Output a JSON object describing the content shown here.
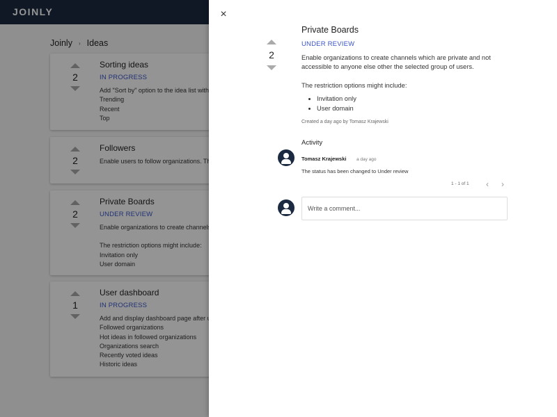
{
  "app": {
    "logo": "JOINLY"
  },
  "breadcrumb": {
    "items": [
      "Joinly",
      "Ideas"
    ],
    "separator": "›"
  },
  "cards": [
    {
      "votes": "2",
      "title": "Sorting ideas",
      "status": "IN PROGRESS",
      "lines": [
        "Add \"Sort by\" option to the idea list with t",
        "Trending",
        "Recent",
        "Top"
      ]
    },
    {
      "votes": "2",
      "title": "Followers",
      "status": "",
      "lines": [
        "Enable users to follow organizations. The"
      ]
    },
    {
      "votes": "2",
      "title": "Private Boards",
      "status": "UNDER REVIEW",
      "lines": [
        "Enable organizations to create channels",
        "",
        "The restriction options might include:",
        "Invitation only",
        "User domain"
      ]
    },
    {
      "votes": "1",
      "title": "User dashboard",
      "status": "IN PROGRESS",
      "lines": [
        "Add and display dashboard page after us",
        "Followed organizations",
        "Hot ideas in followed organizations",
        "Organizations search",
        "Recently voted ideas",
        "Historic ideas"
      ]
    }
  ],
  "drawer": {
    "close_icon": "×",
    "votes": "2",
    "title": "Private Boards",
    "status": "UNDER REVIEW",
    "description_1": "Enable organizations to create channels which are private and not accessible to anyone else other the selected group of users.",
    "description_2": "The restriction options might include:",
    "options": [
      "Invitation only",
      "User domain"
    ],
    "meta": "Created a day ago by Tomasz Krajewski",
    "activity_heading": "Activity",
    "activity": [
      {
        "author": "Tomasz Krajewski",
        "time": "a day ago",
        "message": "The status has been changed to Under review"
      }
    ],
    "pagination": {
      "label": "1 - 1 of 1",
      "prev_icon": "‹",
      "next_icon": "›"
    },
    "comment": {
      "placeholder": "Write a comment..."
    }
  },
  "colors": {
    "topbar": "#1c2a43",
    "status": "#3a55c6",
    "avatar": "#1b2a40"
  }
}
